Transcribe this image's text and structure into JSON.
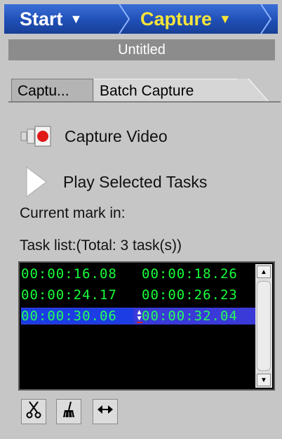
{
  "breadcrumb": {
    "start_label": "Start",
    "capture_label": "Capture",
    "arrow_glyph": "▼"
  },
  "title": "Untitled",
  "tabs": [
    {
      "label": "Captu..."
    },
    {
      "label": "Batch Capture"
    }
  ],
  "actions": {
    "capture_video": "Capture Video",
    "play_selected": "Play Selected Tasks"
  },
  "current_mark_in": "Current mark in:",
  "task_list_label": "Task list:(Total: 3 task(s))",
  "tasks": [
    {
      "mark_in": "00:00:16.08",
      "mark_out": "00:00:18.26"
    },
    {
      "mark_in": "00:00:24.17",
      "mark_out": "00:00:26.23"
    },
    {
      "mark_in": "00:00:30.06",
      "mark_out": "00:00:32.04"
    }
  ],
  "icons": {
    "capture": "camera-record-icon",
    "play": "play-icon",
    "cut": "scissors-icon",
    "clear": "broom-icon",
    "fit": "arrows-horizontal-icon"
  },
  "colors": {
    "topbar": "#1f4fb6",
    "capture_crumb": "#f7e43a",
    "timecode": "#17ff3a",
    "selected_row": "#3a3ad8"
  }
}
